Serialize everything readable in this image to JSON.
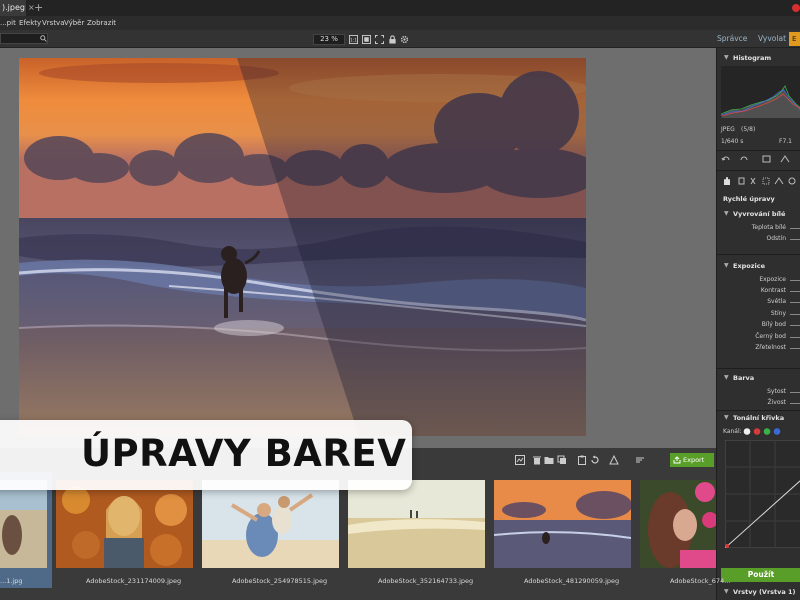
{
  "tab": {
    "title": ").jpeg",
    "close": "×",
    "add": "+"
  },
  "menu": [
    "...pit",
    "Efekty",
    "Vrstva",
    "Výběr",
    "Zobrazit"
  ],
  "toolbar": {
    "zoom": "23 %",
    "zoom_fit": "1:1"
  },
  "modes": {
    "manage": "Správce",
    "develop": "Vyvolat",
    "edit": "E"
  },
  "right_panel": {
    "histogram": {
      "title": "Histogram",
      "format": "JPEG",
      "layer_count": "(5/8)",
      "shutter": "1/640 s",
      "aperture": "F7.1"
    },
    "quick_edits": "Rychlé úpravy",
    "white_balance": {
      "title": "Vyvrování bílé",
      "labels": [
        "Teplota bílé",
        "Odstín"
      ]
    },
    "exposure": {
      "title": "Expozice",
      "labels": [
        "Expozice",
        "Kontrast",
        "Světla",
        "Stíny",
        "Bílý bod",
        "Černý bod",
        "Zřetelnost"
      ]
    },
    "color": {
      "title": "Barva",
      "labels": [
        "Sytost",
        "Živost"
      ]
    },
    "tone_curve": {
      "title": "Tonální křivka",
      "channel": "Kanál:"
    },
    "use_button": "Použít",
    "layers": "Vrstvy (Vrstva 1)"
  },
  "filmbar": {
    "export": "Export"
  },
  "thumbnails": [
    {
      "label": "...1.jpg"
    },
    {
      "label": "AdobeStock_231174009.jpeg"
    },
    {
      "label": "AdobeStock_254978515.jpeg"
    },
    {
      "label": "AdobeStock_352164733.jpeg"
    },
    {
      "label": "AdobeStock_481290059.jpeg"
    },
    {
      "label": "AdobeStock_674..."
    }
  ],
  "banner": "ÚPRAVY BAREV",
  "colors": {
    "accent_green": "#5a9e2a",
    "accent_orange": "#e09a20",
    "thumb_selected": "#4e6a88"
  }
}
